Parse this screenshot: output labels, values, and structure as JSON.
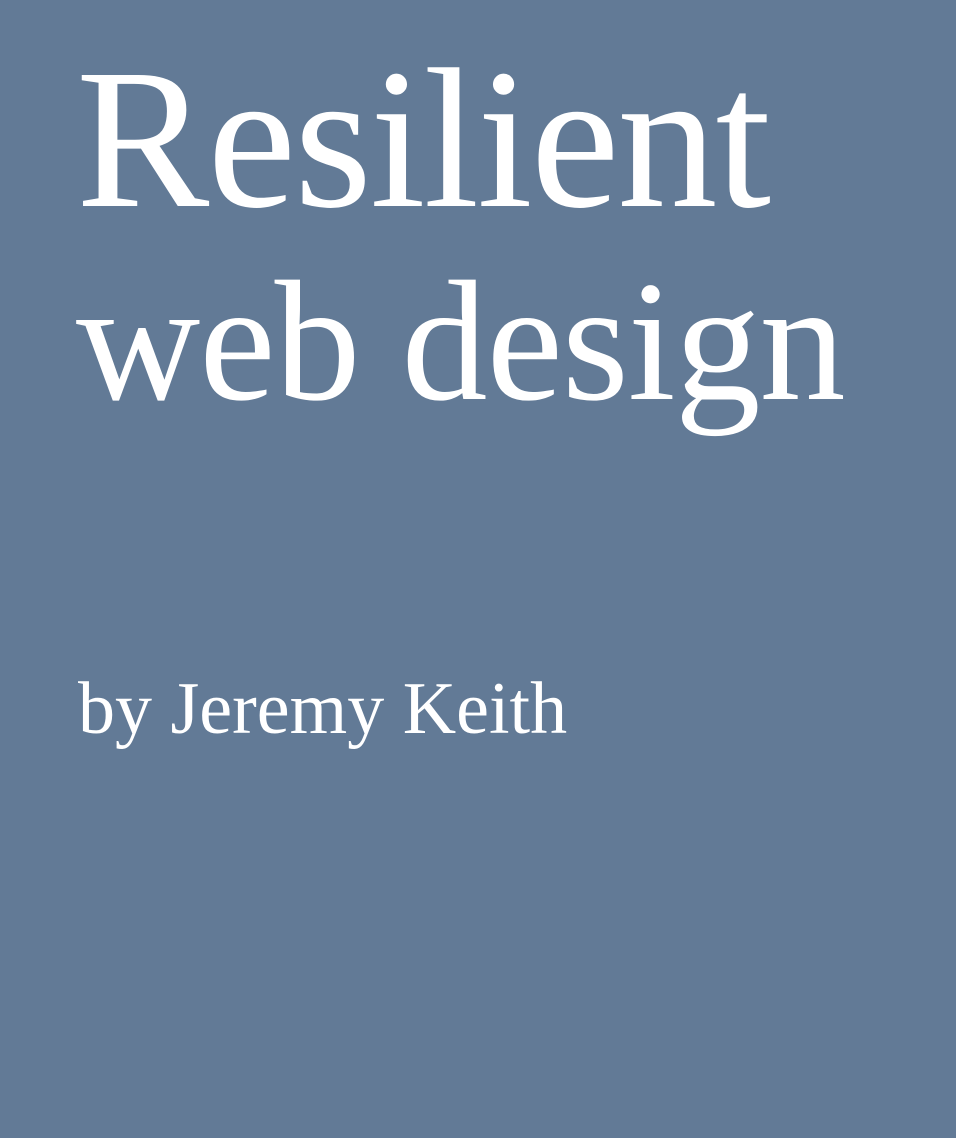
{
  "cover": {
    "title_line_1": "Resilient",
    "title_line_2": "web design",
    "author": "by Jeremy Keith",
    "background_color": "#627a96",
    "text_color": "#ffffff"
  }
}
